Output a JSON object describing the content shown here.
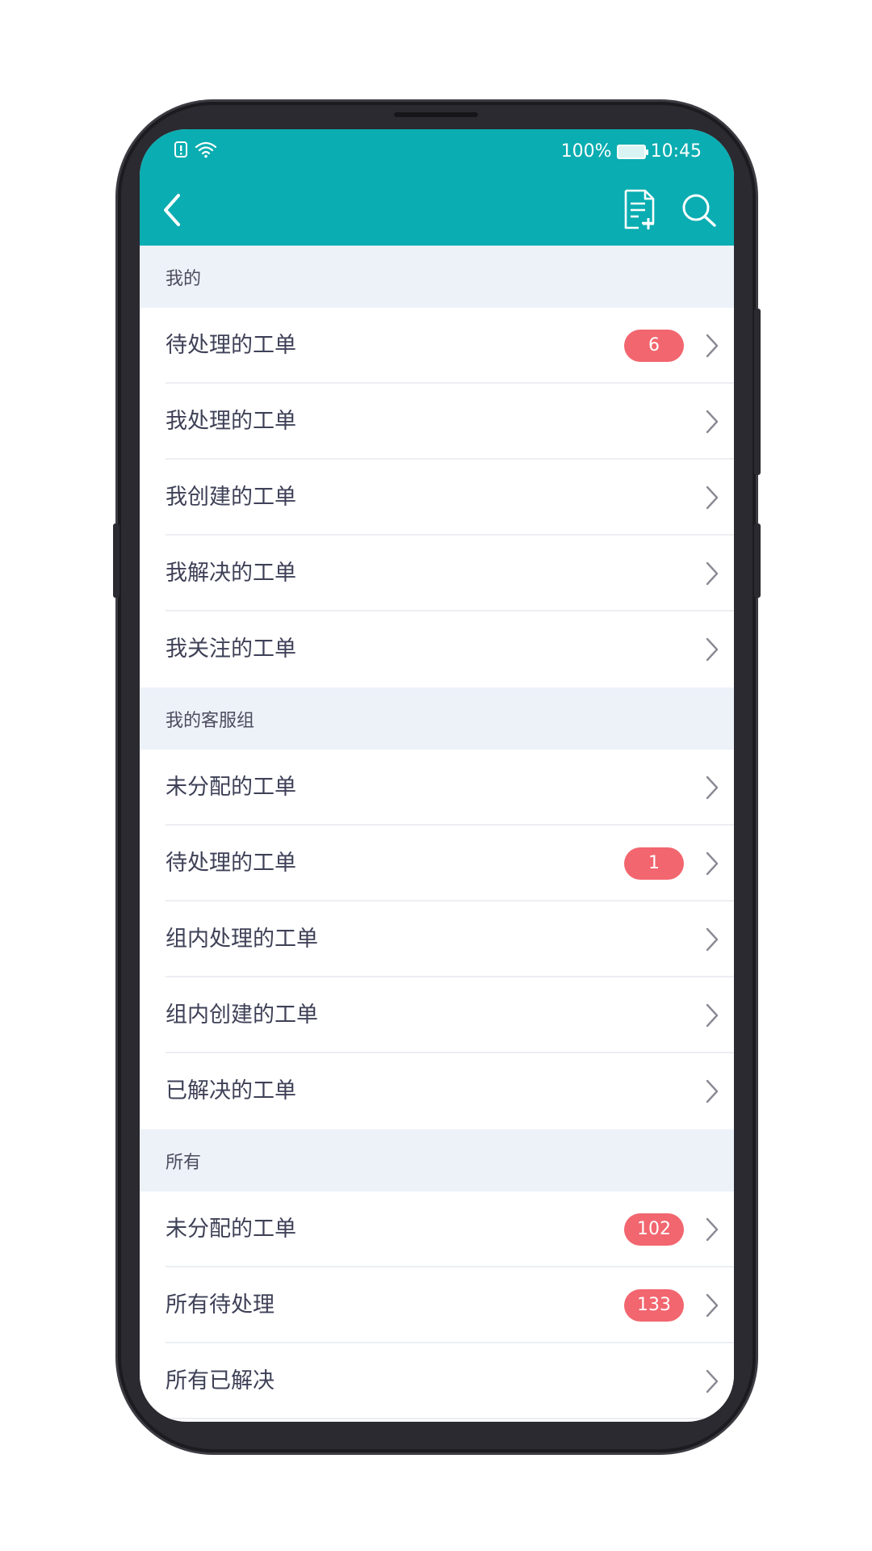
{
  "status_bar": {
    "battery_percent": "100%",
    "time": "10:45",
    "left_icons": [
      "notification-alert-icon",
      "wifi-icon"
    ],
    "battery_icon": "battery-charging-icon"
  },
  "app_bar": {
    "back_icon": "chevron-left-icon",
    "actions": [
      "new-document-icon",
      "search-icon"
    ]
  },
  "colors": {
    "accent": "#0aadb1",
    "badge": "#f2666f",
    "section_bg": "#edf2f9",
    "text": "#3e4157"
  },
  "sections": [
    {
      "title": "我的",
      "items": [
        {
          "label": "待处理的工单",
          "badge": "6"
        },
        {
          "label": "我处理的工单",
          "badge": null
        },
        {
          "label": "我创建的工单",
          "badge": null
        },
        {
          "label": "我解决的工单",
          "badge": null
        },
        {
          "label": "我关注的工单",
          "badge": null
        }
      ]
    },
    {
      "title": "我的客服组",
      "items": [
        {
          "label": "未分配的工单",
          "badge": null
        },
        {
          "label": "待处理的工单",
          "badge": "1"
        },
        {
          "label": "组内处理的工单",
          "badge": null
        },
        {
          "label": "组内创建的工单",
          "badge": null
        },
        {
          "label": "已解决的工单",
          "badge": null
        }
      ]
    },
    {
      "title": "所有",
      "items": [
        {
          "label": "未分配的工单",
          "badge": "102"
        },
        {
          "label": "所有待处理",
          "badge": "133"
        },
        {
          "label": "所有已解决",
          "badge": null
        }
      ]
    }
  ]
}
